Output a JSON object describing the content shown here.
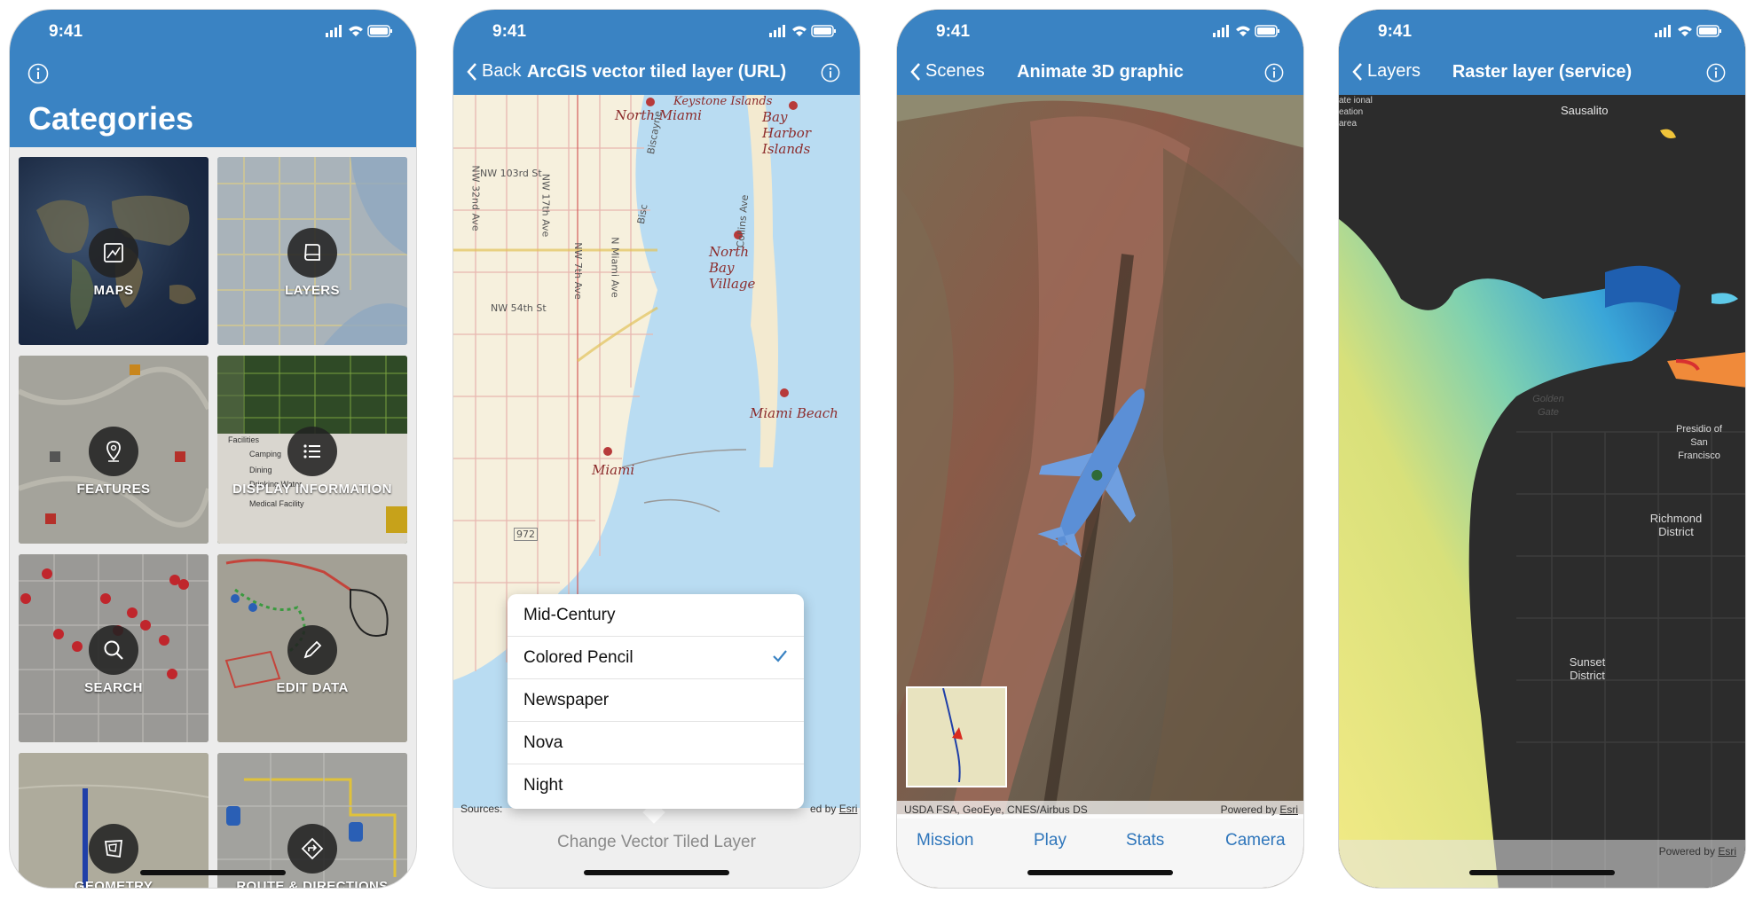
{
  "status": {
    "time": "9:41"
  },
  "screen1": {
    "title": "Categories",
    "tiles": [
      {
        "label": "MAPS",
        "icon": "map-icon"
      },
      {
        "label": "LAYERS",
        "icon": "layers-icon"
      },
      {
        "label": "FEATURES",
        "icon": "feature-pin-icon"
      },
      {
        "label": "DISPLAY INFORMATION",
        "icon": "list-icon"
      },
      {
        "label": "SEARCH",
        "icon": "search-icon"
      },
      {
        "label": "EDIT DATA",
        "icon": "pencil-icon"
      },
      {
        "label": "GEOMETRY",
        "icon": "geometry-icon"
      },
      {
        "label": "ROUTE & DIRECTIONS",
        "icon": "route-icon"
      }
    ],
    "legend": {
      "title": "Facilities",
      "items": [
        "Camping",
        "Dining",
        "Drinking Water",
        "Medical Facility"
      ]
    }
  },
  "screen2": {
    "back": "Back",
    "title": "ArcGIS vector tiled layer (URL)",
    "menu": [
      "Mid-Century",
      "Colored Pencil",
      "Newspaper",
      "Nova",
      "Night"
    ],
    "selected": "Colored Pencil",
    "toolbar": "Change Vector Tiled Layer",
    "attribution_left": "Sources:",
    "attribution_right": "ed by",
    "attribution_link": "Esri",
    "map_labels": [
      "North Miami",
      "Keystone Islands",
      "Bay Harbor Islands",
      "North Bay Village",
      "Miami Beach",
      "Miami"
    ],
    "streets": [
      "NW 103rd St",
      "NW 54th St",
      "NW 32nd Ave",
      "NW 17th Ave",
      "NW 7th Ave",
      "N Miami Ave",
      "Bisc",
      "Biscayne",
      "Collins Ave",
      "972"
    ]
  },
  "screen3": {
    "back": "Scenes",
    "title": "Animate 3D graphic",
    "attribution_left": "USDA FSA, GeoEye, CNES/Airbus DS",
    "attribution_right": "Powered by",
    "attribution_link": "Esri",
    "tabs": [
      "Mission",
      "Play",
      "Stats",
      "Camera"
    ]
  },
  "screen4": {
    "back": "Layers",
    "title": "Raster layer (service)",
    "places": [
      "Sausalito",
      "Golden Gate",
      "Presidio of San Francisco",
      "Richmond District",
      "Sunset District"
    ],
    "attribution_fragment": "ate ional eation area",
    "attribution_right": "Powered by",
    "attribution_link": "Esri"
  }
}
